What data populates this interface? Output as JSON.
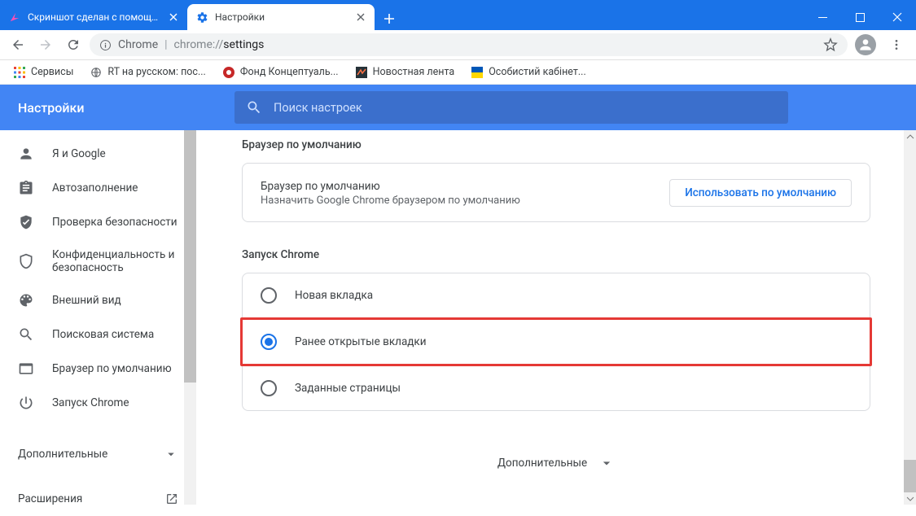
{
  "window": {
    "tabs": [
      {
        "title": "Скриншот сделан с помощью L",
        "active": false
      },
      {
        "title": "Настройки",
        "active": true
      }
    ]
  },
  "addressbar": {
    "secure_label": "Chrome",
    "url_prefix": "chrome://",
    "url_path": "settings"
  },
  "bookmarks": [
    {
      "label": "Сервисы"
    },
    {
      "label": "RT на русском: пос..."
    },
    {
      "label": "Фонд Концептуаль..."
    },
    {
      "label": "Новостная лента"
    },
    {
      "label": "Особистий кабінет..."
    }
  ],
  "header": {
    "title": "Настройки",
    "search_placeholder": "Поиск настроек"
  },
  "sidebar": {
    "items": [
      {
        "label": "Я и Google"
      },
      {
        "label": "Автозаполнение"
      },
      {
        "label": "Проверка безопасности"
      },
      {
        "label": "Конфиденциальность и безопасность"
      },
      {
        "label": "Внешний вид"
      },
      {
        "label": "Поисковая система"
      },
      {
        "label": "Браузер по умолчанию"
      },
      {
        "label": "Запуск Chrome"
      }
    ],
    "more_label": "Дополнительные",
    "extensions_label": "Расширения"
  },
  "content": {
    "default_browser": {
      "section_title": "Браузер по умолчанию",
      "card_title": "Браузер по умолчанию",
      "card_subtitle": "Назначить Google Chrome браузером по умолчанию",
      "button": "Использовать по умолчанию"
    },
    "on_startup": {
      "section_title": "Запуск Chrome",
      "options": [
        {
          "label": "Новая вкладка",
          "checked": false
        },
        {
          "label": "Ранее открытые вкладки",
          "checked": true
        },
        {
          "label": "Заданные страницы",
          "checked": false
        }
      ]
    },
    "footer_more": "Дополнительные"
  }
}
